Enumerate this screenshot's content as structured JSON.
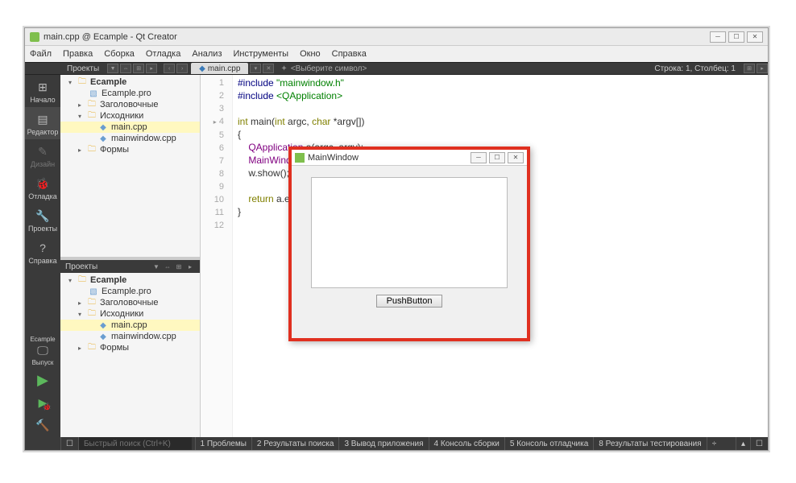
{
  "window": {
    "title": "main.cpp @ Ecample - Qt Creator"
  },
  "menu": [
    "Файл",
    "Правка",
    "Сборка",
    "Отладка",
    "Анализ",
    "Инструменты",
    "Окно",
    "Справка"
  ],
  "toolbar": {
    "panel_label": "Проекты",
    "tab_file": "main.cpp",
    "symbol_prompt": "<Выберите символ>",
    "line_col": "Строка: 1, Столбец: 1"
  },
  "rail": [
    {
      "label": "Начало",
      "icon": "⊞"
    },
    {
      "label": "Редактор",
      "icon": "▤",
      "active": true
    },
    {
      "label": "Дизайн",
      "icon": "✎"
    },
    {
      "label": "Отладка",
      "icon": "🐞"
    },
    {
      "label": "Проекты",
      "icon": "🔧"
    },
    {
      "label": "Справка",
      "icon": "?"
    }
  ],
  "rail_bottom": {
    "proj": "Ecample",
    "target": "Выпуск"
  },
  "tree": {
    "project": "Ecample",
    "profile": "Ecample.pro",
    "headers": "Заголовочные",
    "sources": "Исходники",
    "src_files": [
      "main.cpp",
      "mainwindow.cpp"
    ],
    "forms": "Формы"
  },
  "panel2_label": "Проекты",
  "code": {
    "lines": [
      "#include \"mainwindow.h\"",
      "#include <QApplication>",
      "",
      "int main(int argc, char *argv[])",
      "{",
      "    QApplication a(argc, argv);",
      "    MainWindow w;",
      "    w.show();",
      "",
      "    return a.exec();",
      "}",
      ""
    ]
  },
  "popup": {
    "title": "MainWindow",
    "button": "PushButton"
  },
  "status": {
    "search_ph": "Быстрый поиск (Ctrl+K)",
    "items": [
      "1  Проблемы",
      "2  Результаты поиска",
      "3  Вывод приложения",
      "4  Консоль сборки",
      "5  Консоль отладчика",
      "8  Результаты тестирования"
    ]
  }
}
